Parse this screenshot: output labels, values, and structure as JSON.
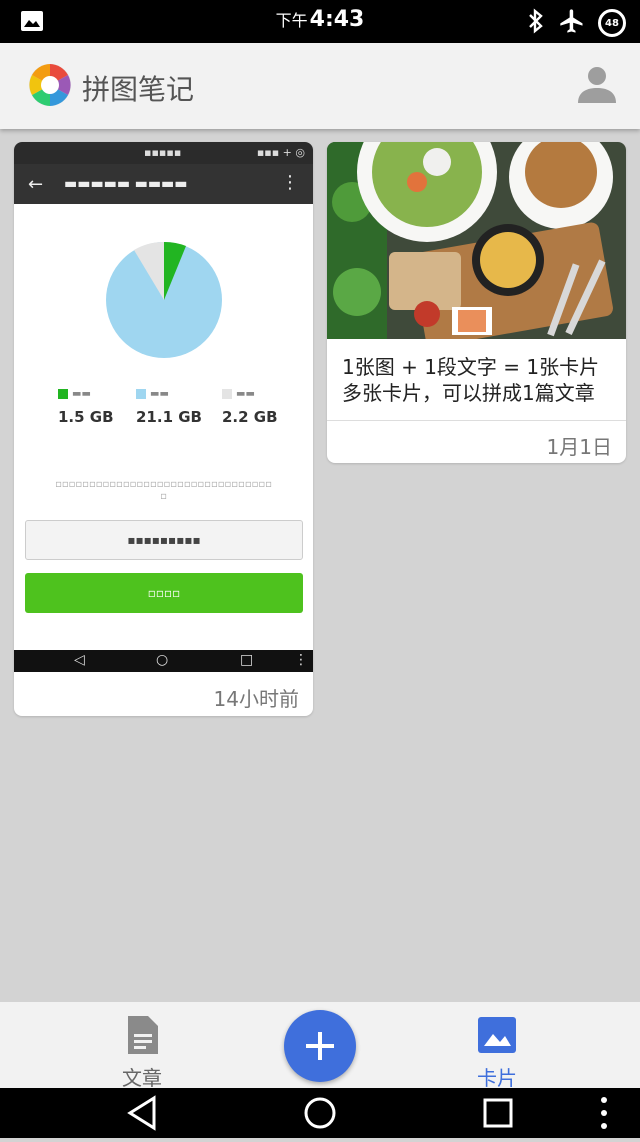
{
  "status_bar": {
    "ampm": "下午",
    "time": "4:43",
    "battery": "48"
  },
  "app": {
    "title": "拼图笔记"
  },
  "cards": [
    {
      "type": "screenshot",
      "time": "14小时前",
      "screenshot": {
        "legend": [
          {
            "value": "1.5 GB",
            "color": "#22b522"
          },
          {
            "value": "21.1 GB",
            "color": "#9fd6f0"
          },
          {
            "value": "2.2 GB",
            "color": "#e4e4e4"
          }
        ]
      }
    },
    {
      "type": "text",
      "text_line1": "1张图 + 1段文字 = 1张卡片",
      "text_line2": "多张卡片，可以拼成1篇文章",
      "time": "1月1日"
    }
  ],
  "bottom_nav": {
    "articles_label": "文章",
    "cards_label": "卡片",
    "active": "cards",
    "accent": "#3f6fdc"
  }
}
